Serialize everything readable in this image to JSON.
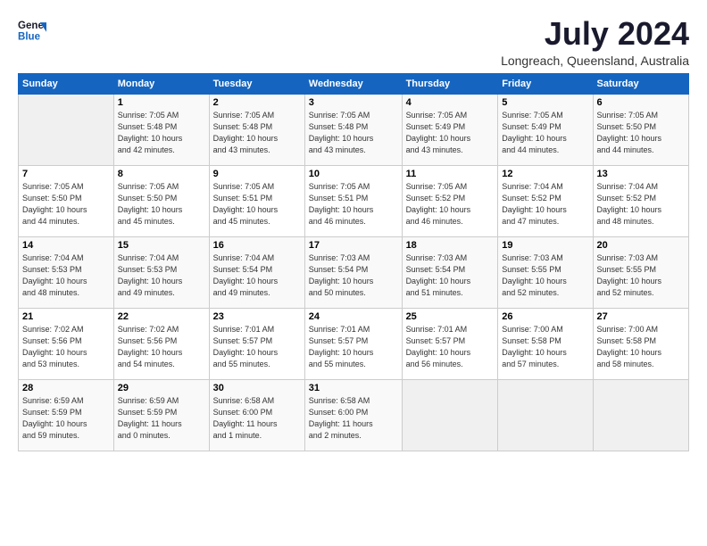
{
  "header": {
    "logo_line1": "General",
    "logo_line2": "Blue",
    "title": "July 2024",
    "location": "Longreach, Queensland, Australia"
  },
  "days_of_week": [
    "Sunday",
    "Monday",
    "Tuesday",
    "Wednesday",
    "Thursday",
    "Friday",
    "Saturday"
  ],
  "weeks": [
    [
      {
        "num": "",
        "info": ""
      },
      {
        "num": "1",
        "info": "Sunrise: 7:05 AM\nSunset: 5:48 PM\nDaylight: 10 hours\nand 42 minutes."
      },
      {
        "num": "2",
        "info": "Sunrise: 7:05 AM\nSunset: 5:48 PM\nDaylight: 10 hours\nand 43 minutes."
      },
      {
        "num": "3",
        "info": "Sunrise: 7:05 AM\nSunset: 5:48 PM\nDaylight: 10 hours\nand 43 minutes."
      },
      {
        "num": "4",
        "info": "Sunrise: 7:05 AM\nSunset: 5:49 PM\nDaylight: 10 hours\nand 43 minutes."
      },
      {
        "num": "5",
        "info": "Sunrise: 7:05 AM\nSunset: 5:49 PM\nDaylight: 10 hours\nand 44 minutes."
      },
      {
        "num": "6",
        "info": "Sunrise: 7:05 AM\nSunset: 5:50 PM\nDaylight: 10 hours\nand 44 minutes."
      }
    ],
    [
      {
        "num": "7",
        "info": "Sunrise: 7:05 AM\nSunset: 5:50 PM\nDaylight: 10 hours\nand 44 minutes."
      },
      {
        "num": "8",
        "info": "Sunrise: 7:05 AM\nSunset: 5:50 PM\nDaylight: 10 hours\nand 45 minutes."
      },
      {
        "num": "9",
        "info": "Sunrise: 7:05 AM\nSunset: 5:51 PM\nDaylight: 10 hours\nand 45 minutes."
      },
      {
        "num": "10",
        "info": "Sunrise: 7:05 AM\nSunset: 5:51 PM\nDaylight: 10 hours\nand 46 minutes."
      },
      {
        "num": "11",
        "info": "Sunrise: 7:05 AM\nSunset: 5:52 PM\nDaylight: 10 hours\nand 46 minutes."
      },
      {
        "num": "12",
        "info": "Sunrise: 7:04 AM\nSunset: 5:52 PM\nDaylight: 10 hours\nand 47 minutes."
      },
      {
        "num": "13",
        "info": "Sunrise: 7:04 AM\nSunset: 5:52 PM\nDaylight: 10 hours\nand 48 minutes."
      }
    ],
    [
      {
        "num": "14",
        "info": "Sunrise: 7:04 AM\nSunset: 5:53 PM\nDaylight: 10 hours\nand 48 minutes."
      },
      {
        "num": "15",
        "info": "Sunrise: 7:04 AM\nSunset: 5:53 PM\nDaylight: 10 hours\nand 49 minutes."
      },
      {
        "num": "16",
        "info": "Sunrise: 7:04 AM\nSunset: 5:54 PM\nDaylight: 10 hours\nand 49 minutes."
      },
      {
        "num": "17",
        "info": "Sunrise: 7:03 AM\nSunset: 5:54 PM\nDaylight: 10 hours\nand 50 minutes."
      },
      {
        "num": "18",
        "info": "Sunrise: 7:03 AM\nSunset: 5:54 PM\nDaylight: 10 hours\nand 51 minutes."
      },
      {
        "num": "19",
        "info": "Sunrise: 7:03 AM\nSunset: 5:55 PM\nDaylight: 10 hours\nand 52 minutes."
      },
      {
        "num": "20",
        "info": "Sunrise: 7:03 AM\nSunset: 5:55 PM\nDaylight: 10 hours\nand 52 minutes."
      }
    ],
    [
      {
        "num": "21",
        "info": "Sunrise: 7:02 AM\nSunset: 5:56 PM\nDaylight: 10 hours\nand 53 minutes."
      },
      {
        "num": "22",
        "info": "Sunrise: 7:02 AM\nSunset: 5:56 PM\nDaylight: 10 hours\nand 54 minutes."
      },
      {
        "num": "23",
        "info": "Sunrise: 7:01 AM\nSunset: 5:57 PM\nDaylight: 10 hours\nand 55 minutes."
      },
      {
        "num": "24",
        "info": "Sunrise: 7:01 AM\nSunset: 5:57 PM\nDaylight: 10 hours\nand 55 minutes."
      },
      {
        "num": "25",
        "info": "Sunrise: 7:01 AM\nSunset: 5:57 PM\nDaylight: 10 hours\nand 56 minutes."
      },
      {
        "num": "26",
        "info": "Sunrise: 7:00 AM\nSunset: 5:58 PM\nDaylight: 10 hours\nand 57 minutes."
      },
      {
        "num": "27",
        "info": "Sunrise: 7:00 AM\nSunset: 5:58 PM\nDaylight: 10 hours\nand 58 minutes."
      }
    ],
    [
      {
        "num": "28",
        "info": "Sunrise: 6:59 AM\nSunset: 5:59 PM\nDaylight: 10 hours\nand 59 minutes."
      },
      {
        "num": "29",
        "info": "Sunrise: 6:59 AM\nSunset: 5:59 PM\nDaylight: 11 hours\nand 0 minutes."
      },
      {
        "num": "30",
        "info": "Sunrise: 6:58 AM\nSunset: 6:00 PM\nDaylight: 11 hours\nand 1 minute."
      },
      {
        "num": "31",
        "info": "Sunrise: 6:58 AM\nSunset: 6:00 PM\nDaylight: 11 hours\nand 2 minutes."
      },
      {
        "num": "",
        "info": ""
      },
      {
        "num": "",
        "info": ""
      },
      {
        "num": "",
        "info": ""
      }
    ]
  ]
}
